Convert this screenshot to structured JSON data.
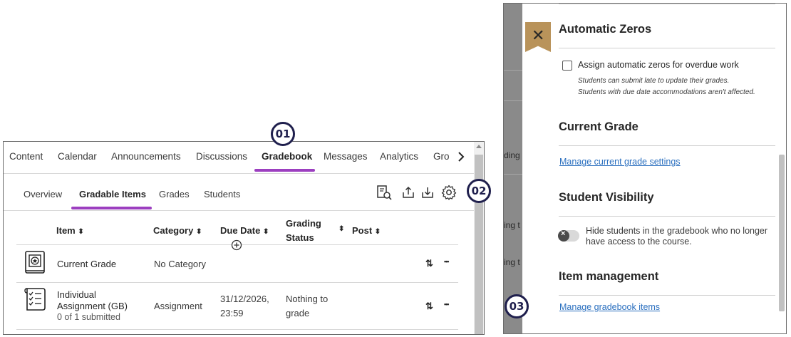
{
  "course_nav": {
    "tabs": [
      "Content",
      "Calendar",
      "Announcements",
      "Discussions",
      "Gradebook",
      "Messages",
      "Analytics",
      "Gro"
    ],
    "active": "Gradebook"
  },
  "gradebook_nav": {
    "tabs": [
      "Overview",
      "Gradable Items",
      "Grades",
      "Students"
    ],
    "active": "Gradable Items"
  },
  "table": {
    "headers": {
      "item": "Item",
      "category": "Category",
      "due_date": "Due Date",
      "grading_status_1": "Grading",
      "grading_status_2": "Status",
      "post": "Post",
      "sort_glyph": "⬍"
    },
    "rows": [
      {
        "item": "Current Grade",
        "category": "No Category",
        "move": "⇅",
        "more": "•••"
      },
      {
        "item_line1": "Individual",
        "item_line2": "Assignment (GB)",
        "sub": "0 of 1 submitted",
        "category": "Assignment",
        "due_line1": "31/12/2026,",
        "due_line2": "23:59",
        "status_line1": "Nothing to",
        "status_line2": "grade",
        "move": "⇅",
        "more": "•••"
      }
    ]
  },
  "badges": [
    "01",
    "02",
    "03"
  ],
  "background_fragments": [
    "ding s",
    "ing t",
    "ing t"
  ],
  "settings_panel": {
    "close": "✕",
    "automatic_zeros": {
      "title": "Automatic Zeros",
      "checkbox_label": "Assign automatic zeros for overdue work",
      "hint_1": "Students can submit late to update their grades.",
      "hint_2": "Students with due date accommodations aren't affected."
    },
    "current_grade": {
      "title": "Current Grade",
      "link": "Manage current grade settings"
    },
    "student_visibility": {
      "title": "Student Visibility",
      "toggle_label": "Hide students in the gradebook who no longer have access to the course.",
      "toggle_on": false
    },
    "item_management": {
      "title": "Item management",
      "link": "Manage gradebook items"
    }
  },
  "colors": {
    "accent": "#9c3fc0",
    "badge": "#1f1f4d",
    "link": "#2a6fbf",
    "close_tag": "#b9935a",
    "overlay": "#8a8a8a"
  },
  "icons": [
    "chevron-right-icon",
    "gradebook-search-icon",
    "export-icon",
    "import-icon",
    "settings-gear-icon",
    "add-column-icon",
    "overall-grade-icon",
    "assignment-checklist-icon",
    "close-icon"
  ]
}
